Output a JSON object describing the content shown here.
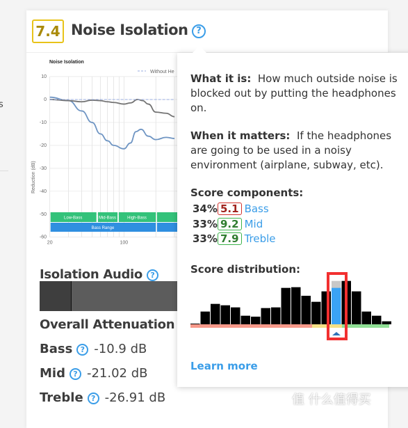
{
  "background": {
    "left_text": "s"
  },
  "section": {
    "score": "7.4",
    "score_color": "#e8c319",
    "title": "Noise Isolation",
    "help_icon": "?"
  },
  "chart": {
    "title": "Noise Isolation",
    "legend": "Without He",
    "ylabel": "Reduction (dB)",
    "yticks": [
      "10",
      "0",
      "-10",
      "-20",
      "-30",
      "-40",
      "-50",
      "-60"
    ],
    "xticks": [
      "20",
      "100"
    ],
    "bands": [
      "Low-Bass",
      "Mid-Bass",
      "High-Bass",
      "Bass Range"
    ]
  },
  "chart_data": {
    "type": "line",
    "title": "Noise Isolation",
    "ylabel": "Reduction (dB)",
    "xscale": "log",
    "ylim": [
      -60,
      10
    ],
    "grid": true,
    "series": [
      {
        "color": "#6f95c3",
        "x": [
          20,
          30,
          40,
          50,
          60,
          70,
          80,
          100,
          115,
          130,
          145,
          170,
          200,
          250,
          300
        ],
        "y": [
          1,
          -0.5,
          -5,
          -10,
          -15,
          -18,
          -20,
          -21.5,
          -19,
          -14,
          -13,
          -16,
          -17.5,
          -16.5,
          -17
        ]
      },
      {
        "color": "#737373",
        "x": [
          20,
          30,
          40,
          50,
          60,
          70,
          80,
          100,
          115,
          135,
          150,
          170,
          200,
          250,
          300
        ],
        "y": [
          0,
          -0.5,
          -1,
          -0.3,
          -0.5,
          -1,
          -1.3,
          -2,
          -1.5,
          0,
          -0.5,
          -2,
          -5.5,
          -6,
          -7.5
        ]
      },
      {
        "name": "Without He",
        "color": "#9aaee0",
        "dashed": true,
        "x": [
          20,
          300
        ],
        "y": [
          0,
          0
        ]
      }
    ]
  },
  "isolation_audio": {
    "label": "Isolation Audio",
    "level": 0.23
  },
  "overall": {
    "label": "Overall Attenuation"
  },
  "measurements": [
    {
      "label": "Bass",
      "value": "-10.9 dB"
    },
    {
      "label": "Mid",
      "value": "-21.02 dB"
    },
    {
      "label": "Treble",
      "value": "-26.91 dB"
    }
  ],
  "tooltip": {
    "what_label": "What it is:",
    "what_text": "How much outside noise is blocked out by putting the headphones on.",
    "when_label": "When it matters:",
    "when_text": "If the headphones are going to be used in a noisy environment (airplane, subway, etc).",
    "components_label": "Score components:",
    "components": [
      {
        "pct": "34%",
        "score": "5.1",
        "name": "Bass",
        "color": "#d2322d"
      },
      {
        "pct": "33%",
        "score": "9.2",
        "name": "Mid",
        "color": "#3cb34a"
      },
      {
        "pct": "33%",
        "score": "7.9",
        "name": "Treble",
        "color": "#3cb34a"
      }
    ],
    "distribution_label": "Score distribution:",
    "distribution": [
      3,
      55,
      88,
      82,
      73,
      37,
      33,
      70,
      73,
      157,
      160,
      123,
      97,
      142,
      187,
      187,
      142,
      55,
      37,
      13
    ],
    "highlight_index": 14,
    "highlight_value": 157,
    "learn_more": "Learn more"
  },
  "watermark": "值 什么值得买"
}
